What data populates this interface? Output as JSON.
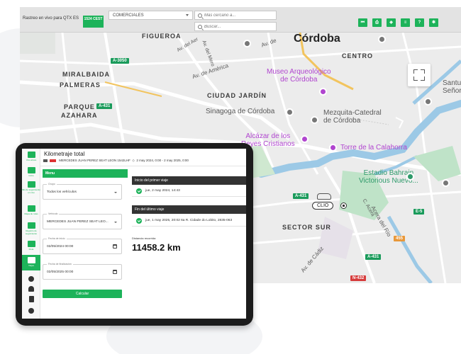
{
  "topbar": {
    "app_title": "Rastreo en vivo para QTX ES",
    "time_badge": "1524 CEST",
    "category_select": "COMERCIALES",
    "nearby_placeholder": "Más cercano a...",
    "search_placeholder": "Buscar...",
    "buttons": [
      {
        "icon": "skip-back-icon",
        "glyph": "⏮"
      },
      {
        "icon": "printer-icon",
        "glyph": "⎙"
      },
      {
        "icon": "layers-icon",
        "glyph": "◈"
      },
      {
        "icon": "list-icon",
        "glyph": "≡"
      },
      {
        "icon": "help-icon",
        "glyph": "?"
      },
      {
        "icon": "gear-icon",
        "glyph": "✱"
      }
    ],
    "accent": "#1db35a"
  },
  "map": {
    "city": "Córdoba",
    "labels": {
      "figueroa": "FIGUEROA",
      "centro": "CENTRO",
      "miralbaida": "MIRALBAIDA",
      "palmeras": "PALMERAS",
      "parque_azahara_1": "PARQUE",
      "parque_azahara_2": "AZAHARA",
      "ciudad_jardin": "CIUDAD JARDÍN",
      "sector_sur": "SECTOR SUR",
      "museo_1": "Museo Arqueológico",
      "museo_2": "de Córdoba",
      "sinagoga": "Sinagoga de Córdoba",
      "mezquita_1": "Mezquita-Catedral",
      "mezquita_2": "de Córdoba",
      "alcazar_1": "Alcázar de los",
      "alcazar_2": "Reyes Cristianos",
      "torre": "Torre de la Calahorra",
      "estadio_1": "Estadio Bahrain",
      "estadio_2": "Victorious Nuevo...",
      "santuario_1": "Santuar",
      "santuario_2": "Señora",
      "av_america": "Av. de América",
      "av_del_aeropuerto": "Av. del Aer",
      "acera_del_rio": "Acera del Río",
      "av_de_cadiz": "Av. de Cádiz",
      "av_de": "Av. de",
      "av_mero": "Av. del Mero",
      "c_acera": "C. Acera",
      "lbl_c": "C"
    },
    "roads": {
      "a3050": "A-3050",
      "a431_1": "A-431",
      "a431_2": "A-431",
      "a431_3": "A-431",
      "e5": "E-5",
      "r455": "455",
      "n432": "N-432"
    },
    "vehicle_label": "CLIO"
  },
  "tablet": {
    "header_title": "Kilometraje total",
    "vehicle": "MERCEDES JUAN PEREZ SEAT LEON 1542LHF",
    "date_range": "2 may 2024, 0:00  -  2 may 2025, 0:00",
    "sidebar": [
      {
        "icon": "live-view-icon",
        "label": "Vivo ahora"
      },
      {
        "icon": "home-icon",
        "label": "Inicio"
      },
      {
        "icon": "tracking-icon",
        "label": "Mis de seguimiento en vivo"
      },
      {
        "icon": "trips-icon",
        "label": "Mapa de rutas"
      },
      {
        "icon": "log-icon",
        "label": "Registro de seguimiento"
      },
      {
        "icon": "fleet-icon",
        "label": "Flota"
      },
      {
        "icon": "trips-active-icon",
        "label": "Viajes"
      },
      {
        "icon": "alerts-icon",
        "label": ""
      },
      {
        "icon": "user-icon",
        "label": ""
      },
      {
        "icon": "report-icon",
        "label": ""
      },
      {
        "icon": "settings-icon",
        "label": ""
      }
    ],
    "menu_label": "Menu",
    "group_label": "Grupo",
    "group_value": "Todos los vehículos",
    "vehicle_label": "Vehículo",
    "vehicle_value": "MERCEDES JUAN PEREZ SEAT LEO...",
    "start_label": "Fecha de inicio",
    "start_value": "02/05/2024 00:00",
    "end_label": "Fecha de finalización",
    "end_value": "02/05/2025 00:00",
    "calc_button": "Calcular",
    "first_trip_head": "Inicio del primer viaje",
    "first_trip_value": "jue, 2 may 2024, 14:43",
    "last_trip_head": "Fin del último viaje",
    "last_trip_value": "jue, 1 may 2025, 20:02   6a R. Cidade do Lobito, 2835-063",
    "distance_label": "Distancia recorrida",
    "distance_value": "11458.2 km"
  }
}
